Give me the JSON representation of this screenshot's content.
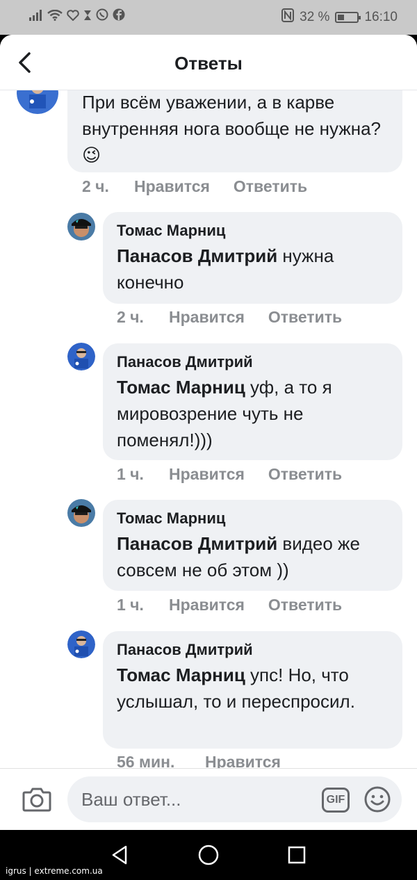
{
  "status_bar": {
    "battery_percent": "32 %",
    "time": "16:10"
  },
  "header": {
    "title": "Ответы"
  },
  "parent_comment": {
    "text": "При всём уважении, а в карве внутренняя нога вообще не нужна?",
    "emoji": "😉",
    "time": "2 ч.",
    "like_label": "Нравится",
    "reply_label": "Ответить"
  },
  "replies": [
    {
      "author": "Томас Марниц",
      "mention": "Панасов Дмитрий",
      "text": " нужна конечно",
      "time": "2 ч.",
      "like_label": "Нравится",
      "reply_label": "Ответить"
    },
    {
      "author": "Панасов Дмитрий",
      "mention": "Томас Марниц",
      "text": " уф, а то я мировозрение чуть не поменял!)))",
      "time": "1 ч.",
      "like_label": "Нравится",
      "reply_label": "Ответить"
    },
    {
      "author": "Томас Марниц",
      "mention": "Панасов Дмитрий",
      "text": " видео же совсем не об этом ))",
      "time": "1 ч.",
      "like_label": "Нравится",
      "reply_label": "Ответить"
    },
    {
      "author": "Панасов Дмитрий",
      "mention": "Томас Марниц",
      "text": " упс! Но, что услышал, то и переспросил.",
      "time": "56 мин.",
      "like_label": "Нравится"
    }
  ],
  "composer": {
    "placeholder": "Ваш ответ...",
    "gif_label": "GIF"
  },
  "watermark": "igrus | extreme.com.ua",
  "colors": {
    "bubble": "#eff1f4",
    "meta": "#8a8d91",
    "text": "#1c1e21"
  }
}
